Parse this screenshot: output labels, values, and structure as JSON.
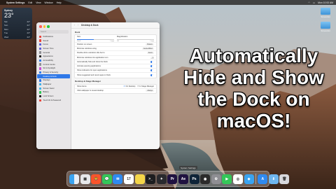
{
  "menubar": {
    "apple": "",
    "app": "System Settings",
    "items": [
      "Edit",
      "View",
      "Window",
      "Help"
    ],
    "right": "Mon 10:53 AM"
  },
  "weather": {
    "city": "Sydney",
    "temp": "23°",
    "forecast": [
      {
        "d": "Sat",
        "t": "22°"
      },
      {
        "d": "Sun",
        "t": "21°"
      },
      {
        "d": "Mon",
        "t": "22°"
      },
      {
        "d": "Tue",
        "t": "23°"
      },
      {
        "d": "Wed",
        "t": "24°"
      }
    ]
  },
  "desktop": {
    "icon1": "Screenshot",
    "icon2": "Screenshot"
  },
  "window": {
    "title": "Desktop & Dock",
    "search_placeholder": "Search",
    "sidebar": [
      {
        "label": "Notifications",
        "color": "#e8433a"
      },
      {
        "label": "Sound",
        "color": "#e8433a"
      },
      {
        "label": "Focus",
        "color": "#5b5bd6"
      },
      {
        "label": "Screen Time",
        "color": "#5b5bd6"
      },
      {
        "label": "General",
        "color": "#8e8e93"
      },
      {
        "label": "Appearance",
        "color": "#222222"
      },
      {
        "label": "Accessibility",
        "color": "#2f78e8"
      },
      {
        "label": "Control Centre",
        "color": "#8e8e93"
      },
      {
        "label": "Siri & Spotlight",
        "color": "#c94dd6"
      },
      {
        "label": "Privacy & Security",
        "color": "#2f78e8"
      },
      {
        "label": "Desktop & Dock",
        "color": "#2f78e8",
        "selected": true
      },
      {
        "label": "Displays",
        "color": "#2f78e8"
      },
      {
        "label": "Wallpaper",
        "color": "#3bb0e8"
      },
      {
        "label": "Screen Saver",
        "color": "#3bb0e8"
      },
      {
        "label": "Battery",
        "color": "#34c759"
      },
      {
        "label": "Lock Screen",
        "color": "#222222"
      },
      {
        "label": "Touch ID & Password",
        "color": "#e8433a"
      }
    ],
    "dock_section": "Dock",
    "size_label": "Size",
    "magnification_label": "Magnification",
    "slider_small": "Small",
    "slider_large": "Large",
    "slider_off": "Off",
    "slider_max": "Large",
    "size_value": 0.45,
    "magnification_value": 0.0,
    "rows": [
      {
        "label": "Position on screen",
        "value": "Bottom"
      },
      {
        "label": "Minimise windows using",
        "value": "Genie Effect"
      },
      {
        "label": "Double-click a window's title bar to",
        "value": "Zoom"
      },
      {
        "label": "Minimise windows into application icon",
        "toggle": false
      },
      {
        "label": "Automatically hide and show the Dock",
        "toggle": true
      },
      {
        "label": "Animate opening applications",
        "toggle": true
      },
      {
        "label": "Show indicators for open applications",
        "toggle": true
      },
      {
        "label": "Show suggested and recent apps in Dock",
        "toggle": true
      }
    ],
    "desktop_section": "Desktop & Stage Manager",
    "show_items_label": "Show Items",
    "show_items_opt1": "On Desktop",
    "show_items_opt2": "In Stage Manager",
    "click_label": "Click wallpaper to reveal desktop",
    "click_value": "Always"
  },
  "overlay": {
    "line1": "Automatically",
    "line2": "Hide and Show",
    "line3": "the Dock on",
    "line4": "macOS!"
  },
  "tooltip": "System Settings",
  "dock": [
    {
      "name": "finder-icon",
      "bg": "linear-gradient(90deg,#3aa3f0 50%,#e8eef6 50%)",
      "g": ""
    },
    {
      "name": "launchpad-icon",
      "bg": "#e8e8ea",
      "g": "▦"
    },
    {
      "name": "brave-icon",
      "bg": "#fb542b",
      "g": "🦁"
    },
    {
      "name": "messages-icon",
      "bg": "#34c759",
      "g": "💬"
    },
    {
      "name": "mail-icon",
      "bg": "#2f8af0",
      "g": "✉"
    },
    {
      "name": "calendar-icon",
      "bg": "#ffffff",
      "g": "17"
    },
    {
      "name": "notes-icon",
      "bg": "#f5d548",
      "g": ""
    },
    {
      "name": "terminal-icon",
      "bg": "#1d1d1f",
      "g": ">_"
    },
    {
      "name": "final-cut-icon",
      "bg": "#2a2a2e",
      "g": "✦"
    },
    {
      "name": "premiere-icon",
      "bg": "#1f1240",
      "g": "Pr"
    },
    {
      "name": "after-effects-icon",
      "bg": "#1f1240",
      "g": "Ae"
    },
    {
      "name": "photoshop-icon",
      "bg": "#0e2438",
      "g": "Ps"
    },
    {
      "name": "obs-icon",
      "bg": "#2b2b2b",
      "g": "◉"
    },
    {
      "name": "system-settings-icon",
      "bg": "#8e8e93",
      "g": "⚙"
    },
    {
      "name": "facetime-icon",
      "bg": "#34c759",
      "g": "▶"
    },
    {
      "name": "chrome-icon",
      "bg": "#ffffff",
      "g": "◎"
    },
    {
      "name": "safari-icon",
      "bg": "#3aa3f0",
      "g": "◈"
    },
    {
      "name": "app-store-icon",
      "bg": "#2f8af0",
      "g": "A"
    },
    {
      "name": "downloads-folder-icon",
      "bg": "#6fb6ee",
      "g": "⬇"
    },
    {
      "name": "trash-icon",
      "bg": "#d8d8dc",
      "g": "🗑"
    }
  ]
}
